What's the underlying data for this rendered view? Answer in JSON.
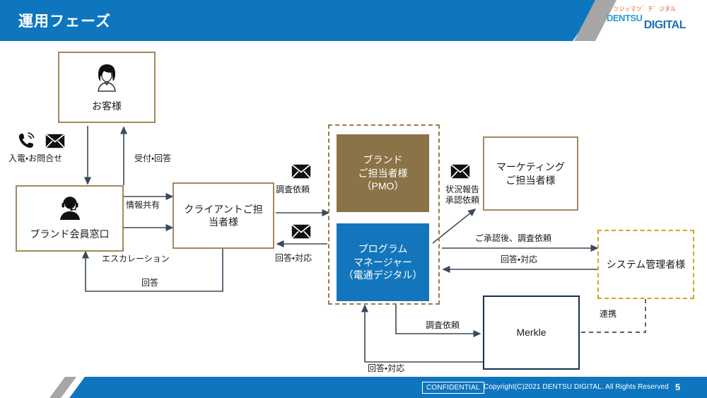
{
  "header": {
    "title": "運用フェーズ",
    "logo_kana": "ツジッマツ゛テ゛ジタル",
    "logo_line1": "DENTSU",
    "logo_line2": "DIGITAL"
  },
  "footer": {
    "confidential": "CONFIDENTIAL",
    "copyright": "Copyright(C)2021 DENTSU DIGITAL. All Rights Reserved",
    "page_number": "5"
  },
  "colors": {
    "header_blue": "#0E76BF",
    "brown_fill": "#8B7348",
    "blue_fill": "#1376BC",
    "brown_line": "#A08A5B",
    "orange_dash": "#D9A228",
    "navy_line": "#19304A",
    "group_dash": "#9A7B3F"
  },
  "boxes": {
    "customer": {
      "label": "お客様",
      "icon": "woman-avatar-icon"
    },
    "brand_desk": {
      "label": "ブランド会員窓口",
      "icon": "headset-agent-icon"
    },
    "client_rep": {
      "label_line1": "クライアントご担",
      "label_line2": "当者様"
    },
    "brand_pmo": {
      "label_line1": "ブランド",
      "label_line2": "ご担当者様",
      "label_line3": "（PMO）"
    },
    "program_manager": {
      "label_line1": "プログラム",
      "label_line2": "マネージャー",
      "label_line3": "（電通デジタル）"
    },
    "marketing_rep": {
      "label_line1": "マーケティング",
      "label_line2": "ご担当者様"
    },
    "system_admin": {
      "label": "システム管理者様"
    },
    "merkle": {
      "label": "Merkle"
    }
  },
  "connector_labels": {
    "incoming_call": "入電・お問合せ",
    "reception_answer": "受付・回答",
    "info_share": "情報共有",
    "escalation": "エスカレーション",
    "answer": "回答",
    "survey_request_1": "調査依頼",
    "answer_handle_1": "回答・対応",
    "status_report_line1": "状況報告",
    "status_report_line2": "承認依頼",
    "after_approval_survey": "ご承認後、調査依頼",
    "answer_handle_2": "回答・対応",
    "survey_request_2": "調査依頼",
    "answer_handle_3": "回答・対応",
    "cooperation": "連携"
  },
  "icons": {
    "phone": "phone-icon",
    "mail_1": "mail-icon",
    "mail_2": "mail-icon",
    "mail_3": "mail-icon",
    "mail_4": "mail-icon"
  }
}
